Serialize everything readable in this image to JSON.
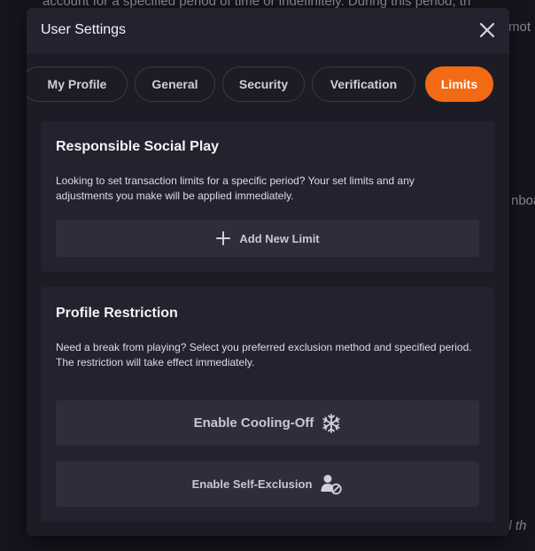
{
  "background": {
    "top_text": "account for a specified period of time or indefinitely. During this period, th",
    "right_text_1": "mot",
    "right_text_2": "nboa",
    "bottom_text": "il th"
  },
  "modal": {
    "title": "User Settings",
    "close_icon": "close-icon"
  },
  "tabs": [
    {
      "label": "My Profile"
    },
    {
      "label": "General"
    },
    {
      "label": "Security"
    },
    {
      "label": "Verification"
    },
    {
      "label": "Limits",
      "active": true
    }
  ],
  "social_play": {
    "title": "Responsible Social Play",
    "description": "Looking to set transaction limits for a specific period? Your set limits and any adjustments you make will be applied immediately.",
    "add_limit_label": "Add New Limit",
    "add_limit_icon": "plus-icon"
  },
  "profile_restriction": {
    "title": "Profile Restriction",
    "description": "Need a break from playing? Select you preferred exclusion method and specified period. The restriction will take effect immediately.",
    "cooling_off_label": "Enable Cooling-Off",
    "cooling_off_icon": "snowflake-icon",
    "self_exclusion_label": "Enable Self-Exclusion",
    "self_exclusion_icon": "user-blocked-icon"
  },
  "colors": {
    "accent": "#f36a14",
    "panel": "#1c1c27",
    "card": "#23232f",
    "button": "#2e2e3b"
  }
}
